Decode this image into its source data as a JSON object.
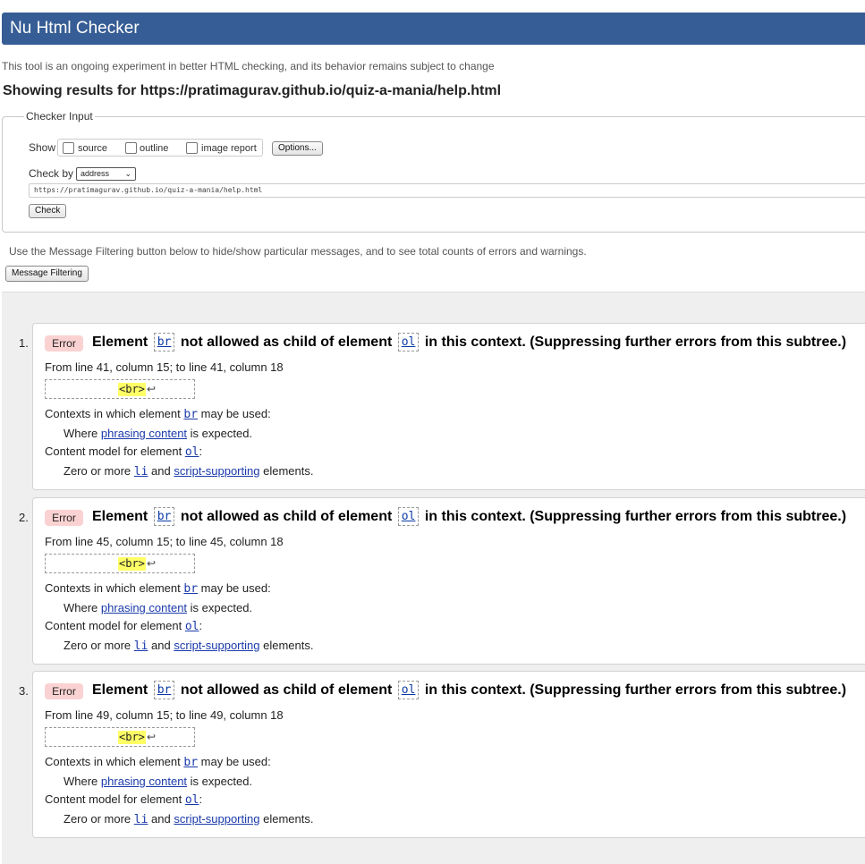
{
  "header": {
    "title": "Nu Html Checker"
  },
  "tagline": "This tool is an ongoing experiment in better HTML checking, and its behavior remains subject to change",
  "results_for": "Showing results for https://pratimagurav.github.io/quiz-a-mania/help.html",
  "checker_input": {
    "legend": "Checker Input",
    "show_label": "Show",
    "options": {
      "source": "source",
      "outline": "outline",
      "image_report": "image report"
    },
    "options_button": "Options...",
    "check_by_label": "Check by",
    "check_by_value": "address",
    "url_value": "https://pratimagurav.github.io/quiz-a-mania/help.html",
    "check_button": "Check"
  },
  "filter_hint": "Use the Message Filtering button below to hide/show particular messages, and to see total counts of errors and warnings.",
  "filter_button": "Message Filtering",
  "messages": [
    {
      "number": "1.",
      "badge": "Error",
      "title_a": "Element",
      "code1": "br",
      "title_b": "not allowed as child of element",
      "code2": "ol",
      "title_c": "in this context. (Suppressing further errors from this subtree.)",
      "location": "From line 41, column 15; to line 41, column 18",
      "extract_tag": "<br>",
      "extract_return": "↩",
      "contexts_pre": "Contexts in which element",
      "contexts_code": "br",
      "contexts_post": "may be used:",
      "where_pre": "Where",
      "where_link": "phrasing content",
      "where_post": "is expected.",
      "model_pre": "Content model for element",
      "model_code": "ol",
      "model_post": ":",
      "zero_pre": "Zero or more",
      "zero_code": "li",
      "zero_mid": "and",
      "zero_link": "script-supporting",
      "zero_post": "elements."
    },
    {
      "number": "2.",
      "badge": "Error",
      "title_a": "Element",
      "code1": "br",
      "title_b": "not allowed as child of element",
      "code2": "ol",
      "title_c": "in this context. (Suppressing further errors from this subtree.)",
      "location": "From line 45, column 15; to line 45, column 18",
      "extract_tag": "<br>",
      "extract_return": "↩",
      "contexts_pre": "Contexts in which element",
      "contexts_code": "br",
      "contexts_post": "may be used:",
      "where_pre": "Where",
      "where_link": "phrasing content",
      "where_post": "is expected.",
      "model_pre": "Content model for element",
      "model_code": "ol",
      "model_post": ":",
      "zero_pre": "Zero or more",
      "zero_code": "li",
      "zero_mid": "and",
      "zero_link": "script-supporting",
      "zero_post": "elements."
    },
    {
      "number": "3.",
      "badge": "Error",
      "title_a": "Element",
      "code1": "br",
      "title_b": "not allowed as child of element",
      "code2": "ol",
      "title_c": "in this context. (Suppressing further errors from this subtree.)",
      "location": "From line 49, column 15; to line 49, column 18",
      "extract_tag": "<br>",
      "extract_return": "↩",
      "contexts_pre": "Contexts in which element",
      "contexts_code": "br",
      "contexts_post": "may be used:",
      "where_pre": "Where",
      "where_link": "phrasing content",
      "where_post": "is expected.",
      "model_pre": "Content model for element",
      "model_code": "ol",
      "model_post": ":",
      "zero_pre": "Zero or more",
      "zero_code": "li",
      "zero_mid": "and",
      "zero_link": "script-supporting",
      "zero_post": "elements."
    }
  ]
}
